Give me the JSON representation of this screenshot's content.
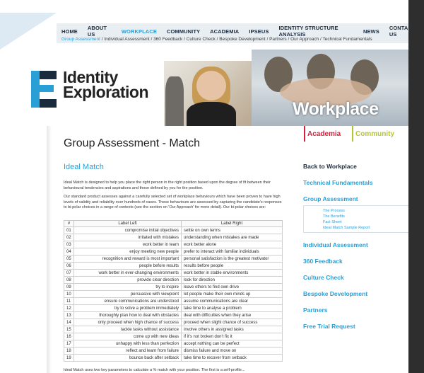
{
  "nav": {
    "items": [
      "HOME",
      "ABOUT US",
      "WORKPLACE",
      "COMMUNITY",
      "ACADEMIA",
      "IPSEUS",
      "IDENTITY STRUCTURE ANALYSIS",
      "NEWS",
      "CONTACT US"
    ],
    "active_index": 2
  },
  "breadcrumb": {
    "active": "Group Assessment",
    "rest": " / Individual Assessment / 360 Feedback / Culture Check / Bespoke Development / Partners / Our Approach / Technical Fundamentals"
  },
  "logo": {
    "line1": "Identity",
    "line2": "Exploration"
  },
  "banner": {
    "title": "Workplace"
  },
  "tabs": {
    "academia": "Academia",
    "community": "Community"
  },
  "main": {
    "title": "Group Assessment - Match",
    "section": "Ideal Match",
    "para1": "Ideal Match is designed to help you place the right person in the right position based upon the degree of fit between their behavioural tendencies and aspirations and those defined by you for the position.",
    "para2": "Our standard product assesses against a carefully selected set of workplace behaviours which have been proven to have high levels of validity and reliability over hundreds of cases. These behaviours are assessed by capturing the candidate's responses to bi-polar choices in a range of contexts (see the section on 'Our Approach' for more detail). Our bi-polar choices are:",
    "footnote": "Ideal Match uses two key parameters to calculate a % match with your position. The first is a self-profile..."
  },
  "table": {
    "headers": [
      "#",
      "Label Left",
      "Label Right"
    ],
    "rows": [
      [
        "01",
        "compromise initial objectives",
        "settle on own terms"
      ],
      [
        "02",
        "irritated with mistakes",
        "understanding when mistakes are made"
      ],
      [
        "03",
        "work better in team",
        "work better alone"
      ],
      [
        "04",
        "enjoy meeting new people",
        "prefer to interact with familiar individuals"
      ],
      [
        "05",
        "recognition and reward is most important",
        "personal satisfaction is the greatest motivator"
      ],
      [
        "06",
        "people before results",
        "results before people"
      ],
      [
        "07",
        "work better in ever-changing environments",
        "work better in stable environments"
      ],
      [
        "08",
        "provide clear direction",
        "look for direction"
      ],
      [
        "09",
        "try to inspire",
        "leave others to find own drive"
      ],
      [
        "10",
        "persuasive with viewpoint",
        "let people make their own minds up"
      ],
      [
        "11",
        "ensure communications are understood",
        "assume communications are clear"
      ],
      [
        "12",
        "try to solve a problem immediately",
        "take time to analyse a problem"
      ],
      [
        "13",
        "thoroughly plan how to deal with obstacles",
        "deal with difficulties when they arise"
      ],
      [
        "14",
        "only proceed when high chance of success",
        "proceed when slight chance of success"
      ],
      [
        "15",
        "tackle tasks without assistance",
        "involve others in assigned tasks"
      ],
      [
        "16",
        "come up with new ideas",
        "if it's not broken don't fix it"
      ],
      [
        "17",
        "unhappy with less than perfection",
        "accept nothing can be perfect"
      ],
      [
        "18",
        "reflect and learn from failure",
        "dismiss failure and move on"
      ],
      [
        "19",
        "bounce back after setback",
        "take time to recover from setback"
      ]
    ]
  },
  "sidebar": {
    "back": "Back to Workplace",
    "technical": "Technical Fundamentals",
    "group": "Group Assessment",
    "sub": [
      "The Process",
      "The Benefits",
      "Fact Sheet",
      "Ideal Match Sample Report"
    ],
    "individual": "Individual Assessment",
    "feedback": "360 Feedback",
    "culture": "Culture Check",
    "bespoke": "Bespoke Development",
    "partners": "Partners",
    "trial": "Free Trial Request"
  },
  "colors": {
    "accent": "#2a9fd6",
    "academia": "#d81e3a",
    "community": "#b6c632",
    "dark": "#1b2b3e"
  },
  "icons": {
    "logo": "identity-exploration-logo-mark"
  }
}
